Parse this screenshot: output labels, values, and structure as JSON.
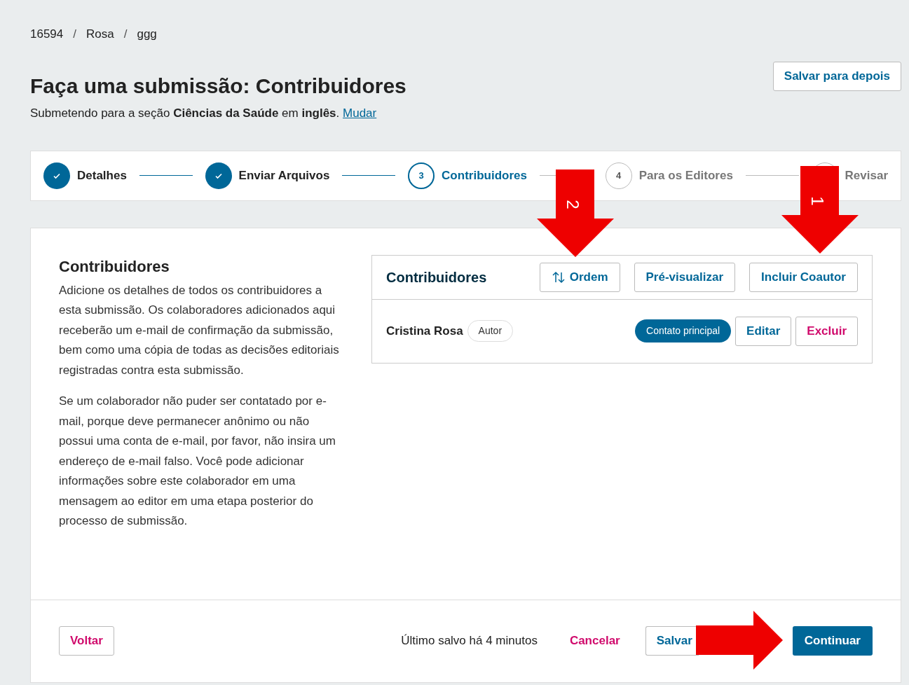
{
  "breadcrumbs": [
    {
      "label": "16594"
    },
    {
      "separator": "/",
      "label": "Rosa"
    },
    {
      "separator": "/",
      "label": "ggg"
    }
  ],
  "page": {
    "title": "Faça uma submissão: Contribuidores",
    "subtitle": "Submetendo para a seção **Ciências da Saúde** em **inglês**.",
    "change_link": "Mudar",
    "save_later": "Salvar para depois"
  },
  "steps": [
    {
      "label": "Detalhes",
      "completed": true,
      "selected": false
    },
    {
      "label": "Enviar Arquivos",
      "completed": true,
      "selected": false
    },
    {
      "label": "Contribuidores",
      "number": "3",
      "completed": false,
      "selected": true
    },
    {
      "label": "Para os Editores",
      "number": "4",
      "completed": false,
      "selected": false
    },
    {
      "label": "Revisar",
      "completed": false,
      "selected": false
    }
  ],
  "section": {
    "title": "Contribuidores",
    "paragraphs": [
      "Adicione os detalhes de todos os contribuidores a esta submissão. Os colaboradores adicionados aqui receberão um e-mail de confirmação da submissão, bem como uma cópia de todas as decisões editoriais registradas contra esta submissão.",
      "Se um colaborador não puder ser contatado por e-mail, porque deve permanecer anônimo ou não possui uma conta de e-mail, por favor, não insira um endereço de e-mail falso. Você pode adicionar informações sobre este colaborador em uma mensagem ao editor em uma etapa posterior do processo de submissão."
    ]
  },
  "contributors_panel": {
    "title": "Contribuidores",
    "buttons": [
      "Ordem",
      "Pré-visualizar",
      "Incluir Coautor"
    ],
    "rows": [
      {
        "name": "Cristina Rosa",
        "role": "Autor",
        "primary_contact": "Contato principal",
        "edit": "Editar",
        "delete": "Excluir"
      }
    ]
  },
  "footer": {
    "back": "Voltar",
    "last_saved": "Último salvo há 4 minutos",
    "cancel": "Cancelar",
    "save": "Salvar",
    "continue": "Continuar"
  },
  "annotations": [
    {
      "label": "2"
    },
    {
      "label": "1"
    }
  ]
}
